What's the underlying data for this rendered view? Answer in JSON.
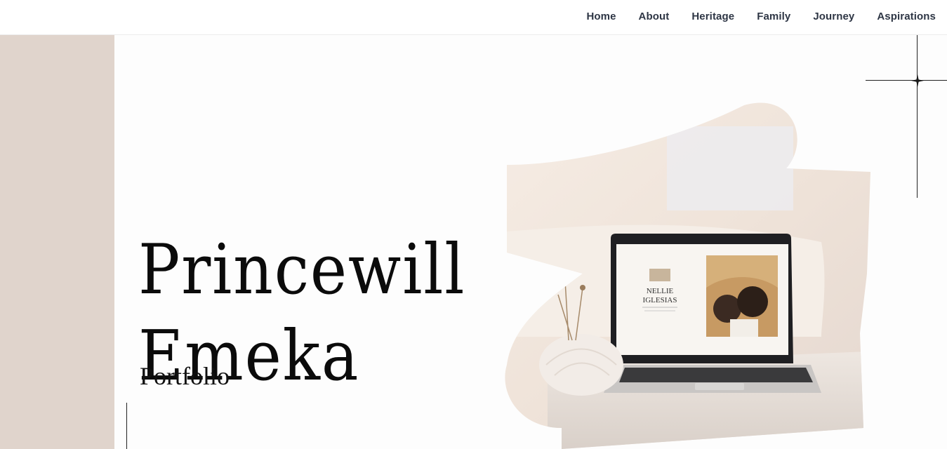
{
  "nav": {
    "items": [
      {
        "label": "Home",
        "name": "nav-home"
      },
      {
        "label": "About",
        "name": "nav-about"
      },
      {
        "label": "Heritage",
        "name": "nav-heritage"
      },
      {
        "label": "Family",
        "name": "nav-family"
      },
      {
        "label": "Journey",
        "name": "nav-journey"
      },
      {
        "label": "Aspirations",
        "name": "nav-aspirations"
      }
    ]
  },
  "hero": {
    "first_name": "Princewill",
    "last_name": "Emeka",
    "subtitle": "Portfolio"
  },
  "hero_image": {
    "screen_name": "NELLIE\nIGLESIAS",
    "screen_name_line1": "NELLIE",
    "screen_name_line2": "IGLESIAS",
    "icon": "laptop-on-table-photo"
  },
  "colors": {
    "left_band": "#e0d4cc",
    "nav_text": "#2e3645",
    "heading": "#0b0b0b",
    "blob": "#f2e7de"
  }
}
